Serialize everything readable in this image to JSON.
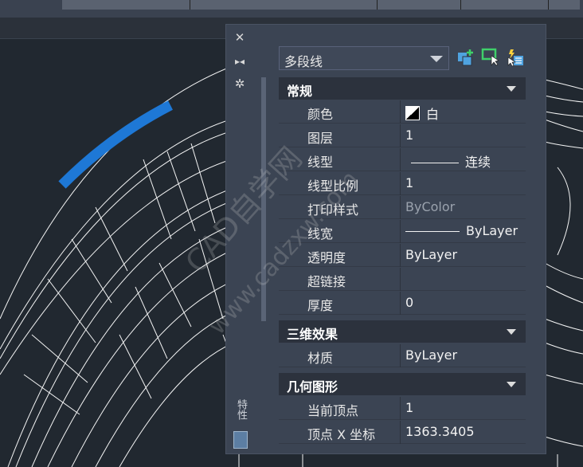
{
  "palette": {
    "side_title": "特性",
    "object_type": "多段线",
    "sections": {
      "general": {
        "title": "常规",
        "rows": [
          {
            "label": "颜色",
            "value": "白"
          },
          {
            "label": "图层",
            "value": "1"
          },
          {
            "label": "线型",
            "value": "连续"
          },
          {
            "label": "线型比例",
            "value": "1"
          },
          {
            "label": "打印样式",
            "value": "ByColor"
          },
          {
            "label": "线宽",
            "value": "ByLayer"
          },
          {
            "label": "透明度",
            "value": "ByLayer"
          },
          {
            "label": "超链接",
            "value": ""
          },
          {
            "label": "厚度",
            "value": "0"
          }
        ]
      },
      "three_d": {
        "title": "三维效果",
        "rows": [
          {
            "label": "材质",
            "value": "ByLayer"
          }
        ]
      },
      "geometry": {
        "title": "几何图形",
        "rows": [
          {
            "label": "当前顶点",
            "value": "1"
          },
          {
            "label": "顶点 X 坐标",
            "value": "1363.3405"
          }
        ]
      }
    }
  },
  "watermark": {
    "line1": "CAD自学网",
    "line2": "www.cadzxw.com"
  },
  "colors": {
    "background": "#212830",
    "panel": "#3b4453",
    "section_header": "#2c323d",
    "highlight_polyline": "#1e78d6",
    "drawing_lines": "#ffffff"
  }
}
